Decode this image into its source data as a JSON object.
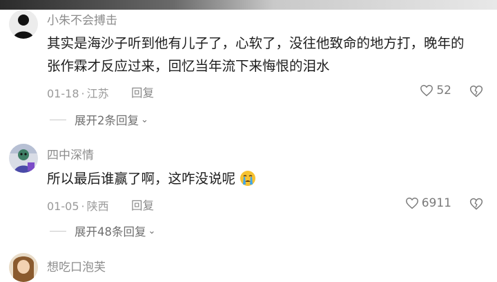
{
  "comments": [
    {
      "username": "小朱不会搏击",
      "content": "其实是海沙子听到他有儿子了，心软了，没往他致命的地方打，晚年的张作霖才反应过来，回忆当年流下来悔恨的泪水",
      "date": "01-18",
      "location": "江苏",
      "reply_label": "回复",
      "likes": "52",
      "expand_label": "展开2条回复"
    },
    {
      "username": "四中深情",
      "content": "所以最后谁赢了啊，这咋没说呢",
      "emoji": "crying-face",
      "date": "01-05",
      "location": "陕西",
      "reply_label": "回复",
      "likes": "6911",
      "expand_label": "展开48条回复"
    },
    {
      "username": "想吃口泡芙"
    }
  ],
  "meta_separator": "·",
  "icons": {
    "like": "heart-outline-icon",
    "dislike": "broken-heart-icon",
    "expand": "chevron-down-icon"
  },
  "colors": {
    "text_primary": "#1d1d1d",
    "text_secondary": "#8c8c8c",
    "emoji_yellow": "#f6c232",
    "emoji_tears": "#3ea6ee"
  }
}
